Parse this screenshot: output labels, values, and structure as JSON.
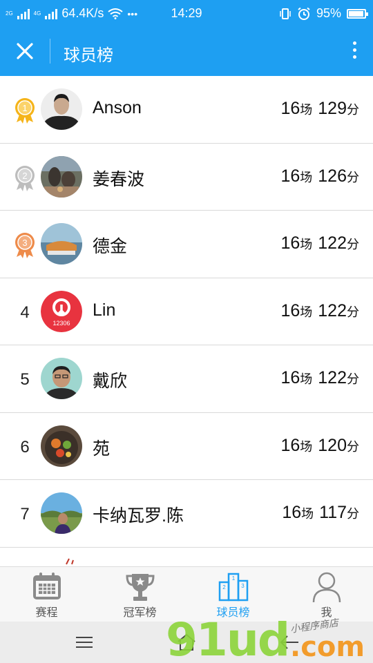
{
  "status_bar": {
    "net_speed": "64.4K/s",
    "time": "14:29",
    "battery": "95%",
    "battery_level": 0.95,
    "net_tags": [
      "2G",
      "4G",
      "2G"
    ],
    "dots": "•••"
  },
  "header": {
    "title": "球员榜",
    "close_icon": "close-icon",
    "more_icon": "more-vertical-icon"
  },
  "players": [
    {
      "rank": "1",
      "medal": "gold",
      "name": "Anson",
      "games": "16",
      "games_unit": "场",
      "points": "129",
      "points_unit": "分"
    },
    {
      "rank": "2",
      "medal": "silver",
      "name": "姜春波",
      "games": "16",
      "games_unit": "场",
      "points": "126",
      "points_unit": "分"
    },
    {
      "rank": "3",
      "medal": "bronze",
      "name": "德金",
      "games": "16",
      "games_unit": "场",
      "points": "122",
      "points_unit": "分"
    },
    {
      "rank": "4",
      "medal": "",
      "name": "Lin",
      "games": "16",
      "games_unit": "场",
      "points": "122",
      "points_unit": "分",
      "avatar_text": "12306"
    },
    {
      "rank": "5",
      "medal": "",
      "name": "戴欣",
      "games": "16",
      "games_unit": "场",
      "points": "122",
      "points_unit": "分"
    },
    {
      "rank": "6",
      "medal": "",
      "name": "苑",
      "games": "16",
      "games_unit": "场",
      "points": "120",
      "points_unit": "分"
    },
    {
      "rank": "7",
      "medal": "",
      "name": "卡纳瓦罗.陈",
      "games": "16",
      "games_unit": "场",
      "points": "117",
      "points_unit": "分"
    }
  ],
  "tabs": [
    {
      "label": "赛程",
      "icon": "calendar-icon",
      "active": false
    },
    {
      "label": "冠军榜",
      "icon": "trophy-icon",
      "active": false
    },
    {
      "label": "球员榜",
      "icon": "podium-icon",
      "active": true
    },
    {
      "label": "我",
      "icon": "user-icon",
      "active": false
    }
  ],
  "watermark": {
    "digits": "91ud",
    "domain": ".com",
    "tagline": "小程序商店"
  },
  "colors": {
    "primary": "#1e9ff2",
    "gold": "#f5b41a",
    "silver": "#bdbdbd",
    "bronze": "#ee8b4a"
  }
}
